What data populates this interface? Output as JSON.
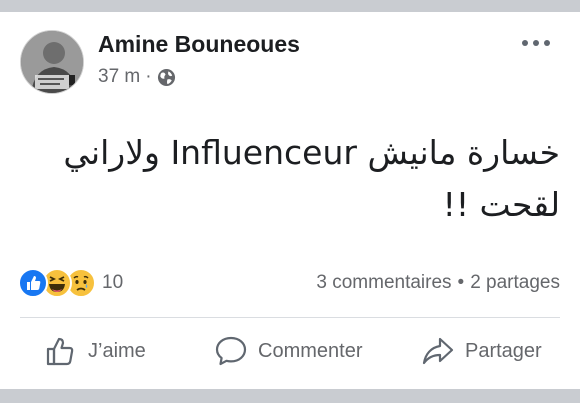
{
  "post": {
    "author": "Amine Bouneoues",
    "time": "37 m",
    "separator": "·",
    "privacy_icon": "globe-icon",
    "text_line1": "خسارة مانيش Influenceur ولاراني",
    "text_line2": "لقحت !!",
    "reactions": {
      "icons": [
        "like-reaction-icon",
        "haha-reaction-icon",
        "sad-reaction-icon"
      ],
      "count": "10"
    },
    "comments": "3 commentaires",
    "shares_sep": "•",
    "shares": "2 partages"
  },
  "actions": {
    "like": "J’aime",
    "comment": "Commenter",
    "share": "Partager"
  },
  "colors": {
    "like_blue": "#1877f2",
    "emoji_yellow": "#f7c13d",
    "text_secondary": "#65676b"
  }
}
